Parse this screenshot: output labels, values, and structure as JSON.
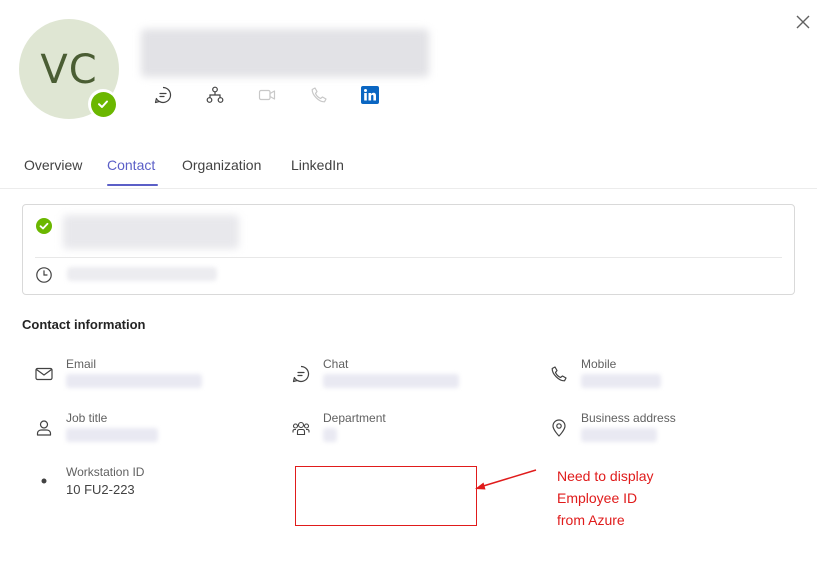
{
  "profile": {
    "initials": "VC",
    "presence": "available",
    "presence_color": "#6bb700",
    "avatar_color": "#dfe6d3"
  },
  "actions": [
    {
      "name": "chat-icon"
    },
    {
      "name": "org-chart-icon"
    },
    {
      "name": "video-call-icon"
    },
    {
      "name": "phone-call-icon"
    },
    {
      "name": "linkedin-icon"
    }
  ],
  "tabs": {
    "overview": "Overview",
    "contact": "Contact",
    "organization": "Organization",
    "linkedin": "LinkedIn",
    "active": "contact",
    "accent_color": "#5b5fc7"
  },
  "contact": {
    "section_title": "Contact information",
    "email_label": "Email",
    "chat_label": "Chat",
    "mobile_label": "Mobile",
    "job_title_label": "Job title",
    "department_label": "Department",
    "business_address_label": "Business address",
    "workstation_label": "Workstation ID",
    "workstation_value": "10 FU2-223"
  },
  "annotation": {
    "line1": "Need to display",
    "line2": "Employee ID",
    "line3": "from Azure",
    "color": "#e01b1b"
  }
}
